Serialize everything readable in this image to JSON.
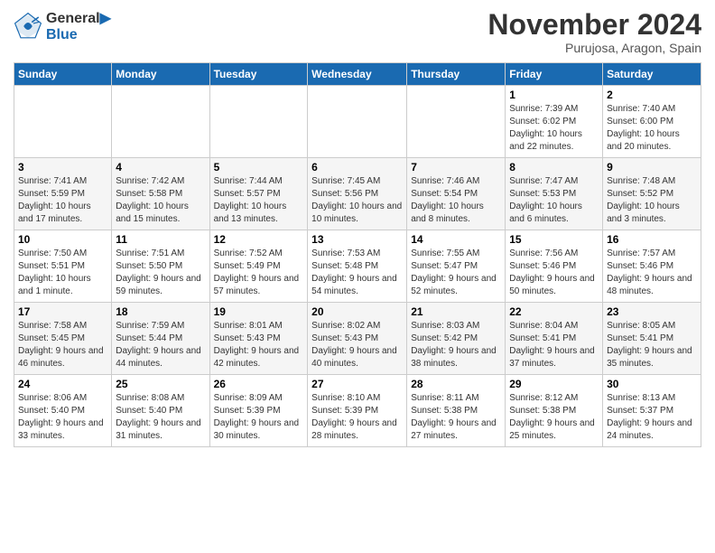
{
  "logo": {
    "line1": "General",
    "line2": "Blue"
  },
  "title": "November 2024",
  "subtitle": "Purujosa, Aragon, Spain",
  "days_of_week": [
    "Sunday",
    "Monday",
    "Tuesday",
    "Wednesday",
    "Thursday",
    "Friday",
    "Saturday"
  ],
  "weeks": [
    [
      {
        "day": "",
        "info": ""
      },
      {
        "day": "",
        "info": ""
      },
      {
        "day": "",
        "info": ""
      },
      {
        "day": "",
        "info": ""
      },
      {
        "day": "",
        "info": ""
      },
      {
        "day": "1",
        "info": "Sunrise: 7:39 AM\nSunset: 6:02 PM\nDaylight: 10 hours and 22 minutes."
      },
      {
        "day": "2",
        "info": "Sunrise: 7:40 AM\nSunset: 6:00 PM\nDaylight: 10 hours and 20 minutes."
      }
    ],
    [
      {
        "day": "3",
        "info": "Sunrise: 7:41 AM\nSunset: 5:59 PM\nDaylight: 10 hours and 17 minutes."
      },
      {
        "day": "4",
        "info": "Sunrise: 7:42 AM\nSunset: 5:58 PM\nDaylight: 10 hours and 15 minutes."
      },
      {
        "day": "5",
        "info": "Sunrise: 7:44 AM\nSunset: 5:57 PM\nDaylight: 10 hours and 13 minutes."
      },
      {
        "day": "6",
        "info": "Sunrise: 7:45 AM\nSunset: 5:56 PM\nDaylight: 10 hours and 10 minutes."
      },
      {
        "day": "7",
        "info": "Sunrise: 7:46 AM\nSunset: 5:54 PM\nDaylight: 10 hours and 8 minutes."
      },
      {
        "day": "8",
        "info": "Sunrise: 7:47 AM\nSunset: 5:53 PM\nDaylight: 10 hours and 6 minutes."
      },
      {
        "day": "9",
        "info": "Sunrise: 7:48 AM\nSunset: 5:52 PM\nDaylight: 10 hours and 3 minutes."
      }
    ],
    [
      {
        "day": "10",
        "info": "Sunrise: 7:50 AM\nSunset: 5:51 PM\nDaylight: 10 hours and 1 minute."
      },
      {
        "day": "11",
        "info": "Sunrise: 7:51 AM\nSunset: 5:50 PM\nDaylight: 9 hours and 59 minutes."
      },
      {
        "day": "12",
        "info": "Sunrise: 7:52 AM\nSunset: 5:49 PM\nDaylight: 9 hours and 57 minutes."
      },
      {
        "day": "13",
        "info": "Sunrise: 7:53 AM\nSunset: 5:48 PM\nDaylight: 9 hours and 54 minutes."
      },
      {
        "day": "14",
        "info": "Sunrise: 7:55 AM\nSunset: 5:47 PM\nDaylight: 9 hours and 52 minutes."
      },
      {
        "day": "15",
        "info": "Sunrise: 7:56 AM\nSunset: 5:46 PM\nDaylight: 9 hours and 50 minutes."
      },
      {
        "day": "16",
        "info": "Sunrise: 7:57 AM\nSunset: 5:46 PM\nDaylight: 9 hours and 48 minutes."
      }
    ],
    [
      {
        "day": "17",
        "info": "Sunrise: 7:58 AM\nSunset: 5:45 PM\nDaylight: 9 hours and 46 minutes."
      },
      {
        "day": "18",
        "info": "Sunrise: 7:59 AM\nSunset: 5:44 PM\nDaylight: 9 hours and 44 minutes."
      },
      {
        "day": "19",
        "info": "Sunrise: 8:01 AM\nSunset: 5:43 PM\nDaylight: 9 hours and 42 minutes."
      },
      {
        "day": "20",
        "info": "Sunrise: 8:02 AM\nSunset: 5:43 PM\nDaylight: 9 hours and 40 minutes."
      },
      {
        "day": "21",
        "info": "Sunrise: 8:03 AM\nSunset: 5:42 PM\nDaylight: 9 hours and 38 minutes."
      },
      {
        "day": "22",
        "info": "Sunrise: 8:04 AM\nSunset: 5:41 PM\nDaylight: 9 hours and 37 minutes."
      },
      {
        "day": "23",
        "info": "Sunrise: 8:05 AM\nSunset: 5:41 PM\nDaylight: 9 hours and 35 minutes."
      }
    ],
    [
      {
        "day": "24",
        "info": "Sunrise: 8:06 AM\nSunset: 5:40 PM\nDaylight: 9 hours and 33 minutes."
      },
      {
        "day": "25",
        "info": "Sunrise: 8:08 AM\nSunset: 5:40 PM\nDaylight: 9 hours and 31 minutes."
      },
      {
        "day": "26",
        "info": "Sunrise: 8:09 AM\nSunset: 5:39 PM\nDaylight: 9 hours and 30 minutes."
      },
      {
        "day": "27",
        "info": "Sunrise: 8:10 AM\nSunset: 5:39 PM\nDaylight: 9 hours and 28 minutes."
      },
      {
        "day": "28",
        "info": "Sunrise: 8:11 AM\nSunset: 5:38 PM\nDaylight: 9 hours and 27 minutes."
      },
      {
        "day": "29",
        "info": "Sunrise: 8:12 AM\nSunset: 5:38 PM\nDaylight: 9 hours and 25 minutes."
      },
      {
        "day": "30",
        "info": "Sunrise: 8:13 AM\nSunset: 5:37 PM\nDaylight: 9 hours and 24 minutes."
      }
    ]
  ]
}
